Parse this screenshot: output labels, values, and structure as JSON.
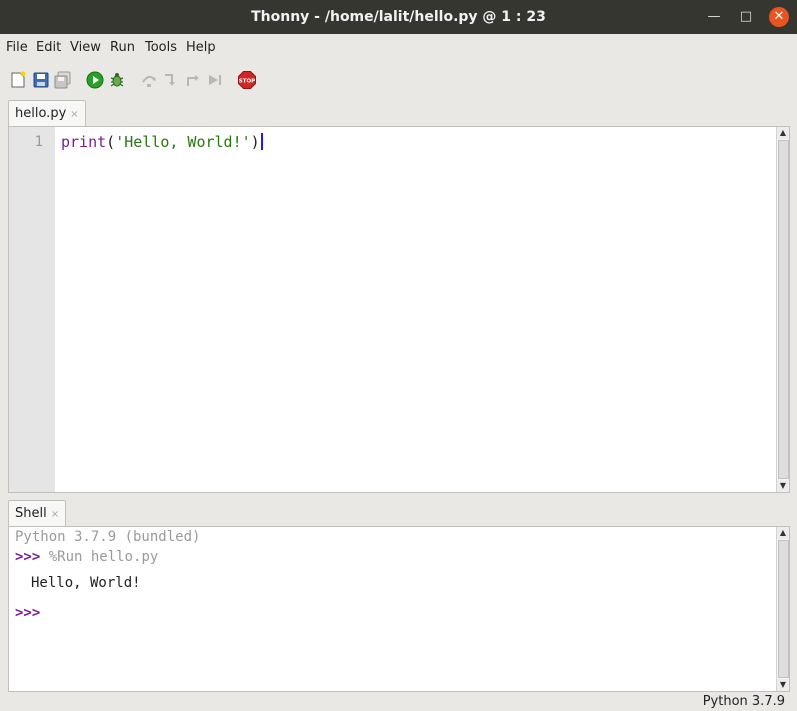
{
  "window": {
    "title": "Thonny  -  /home/lalit/hello.py  @  1 : 23",
    "minimize_glyph": "—",
    "maximize_glyph": "□",
    "close_glyph": "✕"
  },
  "menu": [
    "File",
    "Edit",
    "View",
    "Run",
    "Tools",
    "Help"
  ],
  "toolbar": {
    "icons": [
      "new-file-icon",
      "save-icon",
      "save-all-icon",
      "run-icon",
      "debug-icon",
      "step-over-icon",
      "step-into-icon",
      "step-out-icon",
      "resume-icon",
      "stop-icon"
    ],
    "stop_label": "STOP"
  },
  "editor": {
    "tab": {
      "label": "hello.py",
      "close": "×"
    },
    "line_number": "1",
    "code": {
      "func": "print",
      "open": "(",
      "string": "'Hello, World!'",
      "close": ")"
    }
  },
  "shell": {
    "tab": {
      "label": "Shell",
      "close": "×"
    },
    "banner": "Python 3.7.9 (bundled)",
    "prompt": ">>>",
    "command": "%Run hello.py",
    "output": "Hello, World!"
  },
  "statusbar": {
    "interpreter": "Python 3.7.9"
  }
}
